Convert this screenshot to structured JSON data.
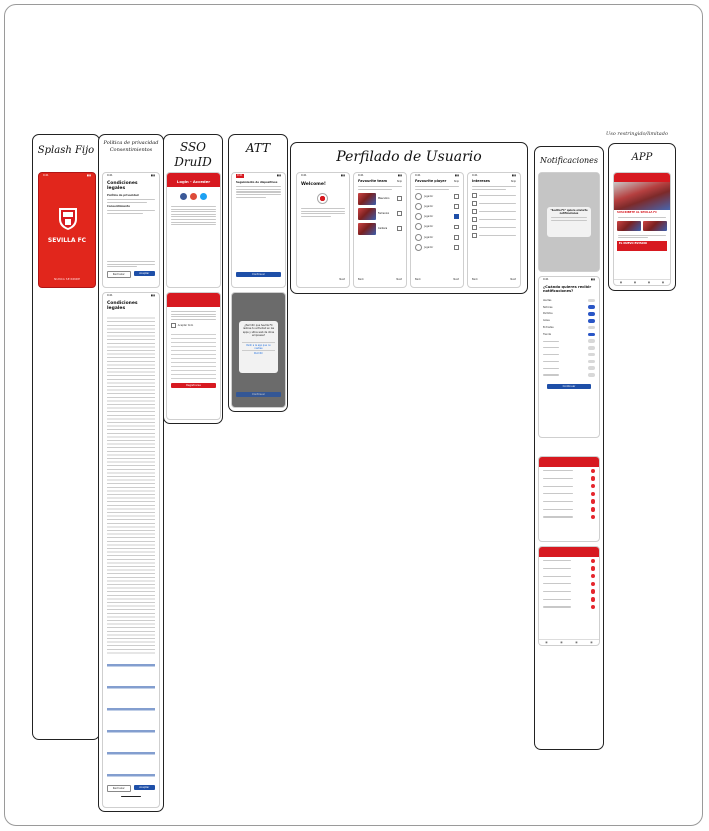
{
  "frames": {
    "splash": {
      "title": "Splash Fijo",
      "brand": "SEVILLA FC",
      "tagline": "NUNCA SE RINDE"
    },
    "privacy": {
      "title_line1": "Política de privacidad",
      "title_line2": "Consentimientos",
      "screen_title": "Condiciones legales",
      "section1": "Política de privacidad",
      "section2": "Consentimiento",
      "reject_label": "Rechazar",
      "accept_label": "Aceptar"
    },
    "sso": {
      "title_line1": "SSO",
      "title_line2": "DruID",
      "header": "Login - Acceder",
      "submit_label": "Registrarse",
      "legal_label": "Aceptar todo"
    },
    "att": {
      "title": "ATT",
      "screen_title": "Seguimiento de dispositivos",
      "dialog_text": "¿Permitir que Sevilla FC rastree tu actividad en las apps y sitios web de otras empresas?",
      "ask_label": "Pedir a la app que no rastree",
      "allow_label": "Permitir",
      "continue_label": "Continuar"
    },
    "profiling": {
      "title": "Perfilado de Usuario",
      "screens": [
        {
          "title": "Welcome!"
        },
        {
          "title": "Favourite team",
          "action": "Skip",
          "options": [
            "Masculino",
            "Femenino",
            "Cantera"
          ]
        },
        {
          "title": "Favourite player",
          "action": "Skip",
          "player": "Jugador"
        },
        {
          "title": "Intereses",
          "action": "Skip"
        }
      ],
      "next_label": "Next",
      "back_label": "Back"
    },
    "notifications": {
      "title": "Notificaciones",
      "question": "¿Cuándo quieres recibir notificaciones?",
      "items": [
        "Alertas",
        "Noticias",
        "Partidos",
        "Goles",
        "Entradas",
        "Tienda"
      ],
      "button": "Continuar",
      "dialog": "\"Sevilla FC\" quiere enviarte notificaciones"
    },
    "app": {
      "note": "Uso restringido/limitado",
      "title": "APP",
      "headline": "SUSCRIBETE AL SEVILLA FC",
      "banner": "EL NUEVO ESTADIO"
    }
  },
  "colors": {
    "brand_red": "#d71920",
    "accent_blue": "#1e4fa8",
    "toggle_blue": "#2a56c6"
  },
  "icons": [
    "sevilla-crest-icon",
    "facebook-icon",
    "google-icon",
    "twitter-icon",
    "player-avatar-icon"
  ]
}
